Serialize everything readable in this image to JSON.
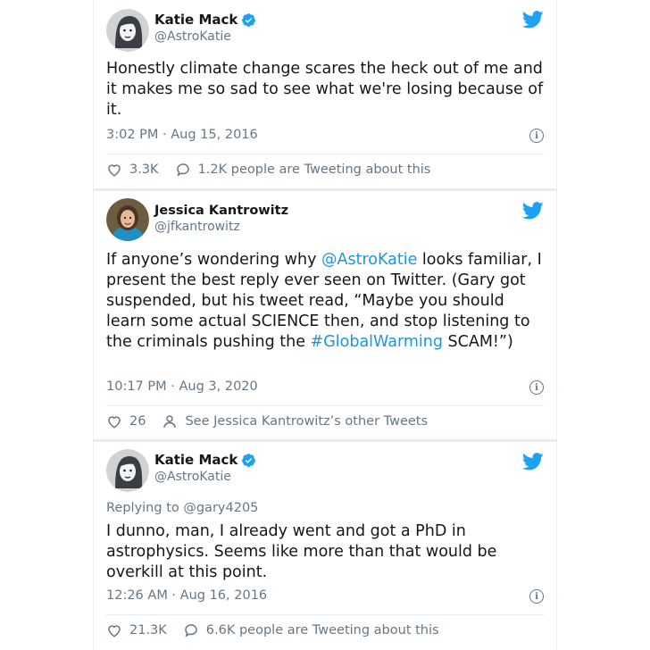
{
  "colors": {
    "twitter_blue": "#1da1f2",
    "link_blue": "#1b95e0",
    "meta_gray": "#657786",
    "text_dark": "#14171a"
  },
  "tweets": [
    {
      "author": {
        "name": "Katie Mack",
        "handle": "@AstroKatie",
        "verified": true,
        "avatar_icon": "cartoon-portrait-avatar"
      },
      "reply_to": null,
      "text_plain": "Honestly climate change scares the heck out of me and it makes me so sad to see what we're losing because of it.",
      "timestamp": "3:02 PM · Aug 15, 2016",
      "likes": "3.3K",
      "secondary_action": "1.2K people are Tweeting about this",
      "secondary_icon": "speech-bubble-icon"
    },
    {
      "author": {
        "name": "Jessica Kantrowitz",
        "handle": "@jfkantrowitz",
        "verified": false,
        "avatar_icon": "photo-avatar"
      },
      "reply_to": null,
      "text_parts": {
        "p1": "If anyone’s wondering why ",
        "mention": "@AstroKatie",
        "p2": " looks familiar, I present the best reply ever seen on Twitter. (Gary got suspended, but his tweet read, “Maybe you should learn some actual SCIENCE then, and stop listening to the criminals pushing the ",
        "hashtag": "#GlobalWarming",
        "p3": " SCAM!”)"
      },
      "timestamp": "10:17 PM · Aug 3, 2020",
      "likes": "26",
      "secondary_action": "See Jessica Kantrowitz’s other Tweets",
      "secondary_icon": "person-icon"
    },
    {
      "author": {
        "name": "Katie Mack",
        "handle": "@AstroKatie",
        "verified": true,
        "avatar_icon": "cartoon-portrait-avatar"
      },
      "reply_to": "Replying to @gary4205",
      "text_plain": "I dunno, man, I already went and got a PhD in astrophysics. Seems like more than that would be overkill at this point.",
      "timestamp": "12:26 AM · Aug 16, 2016",
      "likes": "21.3K",
      "secondary_action": "6.6K people are Tweeting about this",
      "secondary_icon": "speech-bubble-icon"
    }
  ]
}
